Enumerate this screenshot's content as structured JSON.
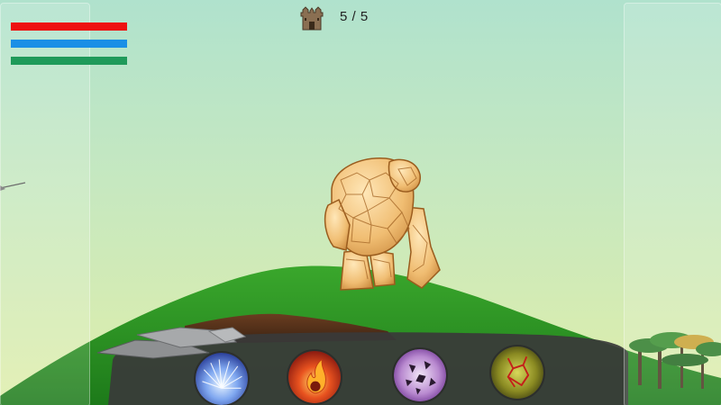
{
  "hud": {
    "bars": [
      {
        "name": "health",
        "color": "#ee1111",
        "level": 1.0
      },
      {
        "name": "mana",
        "color": "#1a8fe6",
        "level": 1.0
      },
      {
        "name": "stamina",
        "color": "#1f9a5a",
        "level": 1.0
      }
    ],
    "castle": {
      "icon": "castle-icon",
      "count_text": "5 / 5"
    }
  },
  "enemy": {
    "icon": "rock-golem-icon"
  },
  "skills": [
    {
      "name": "ice-skill",
      "icon": "ice-burst-icon",
      "color": "#3f5fcf"
    },
    {
      "name": "fire-skill",
      "icon": "fireball-icon",
      "color": "#d9382a"
    },
    {
      "name": "void-skill",
      "icon": "void-shatter-icon",
      "color": "#8b4fb5"
    },
    {
      "name": "earth-skill",
      "icon": "earth-lava-icon",
      "color": "#6a6a1c"
    }
  ]
}
